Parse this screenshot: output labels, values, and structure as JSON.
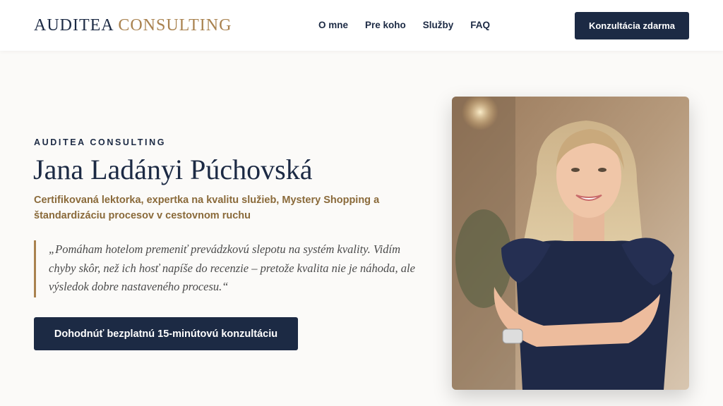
{
  "header": {
    "logo_primary": "AUDITEA",
    "logo_secondary": "CONSULTING",
    "nav": [
      {
        "label": "O mne"
      },
      {
        "label": "Pre koho"
      },
      {
        "label": "Služby"
      },
      {
        "label": "FAQ"
      }
    ],
    "cta_label": "Konzultácia zdarma"
  },
  "hero": {
    "eyebrow": "AUDITEA CONSULTING",
    "name": "Jana Ladányi Púchovská",
    "subtitle": "Certifikovaná lektorka, expertka na kvalitu služieb, Mystery Shopping a štandardizáciu procesov v cestovnom ruchu",
    "quote": "„Pomáham hotelom premeniť prevádzkovú slepotu na systém kvality. Vidím chyby skôr, než ich hosť napíše do recenzie – pretože kvalita nie je náhoda, ale výsledok dobre nastaveného procesu.“",
    "cta_label": "Dohodnúť bezplatnú 15-minútovú konzultáciu"
  },
  "colors": {
    "navy": "#1c2a44",
    "gold": "#a9824f",
    "subtitle_brown": "#8a6a3a",
    "background": "#fbfaf8"
  }
}
